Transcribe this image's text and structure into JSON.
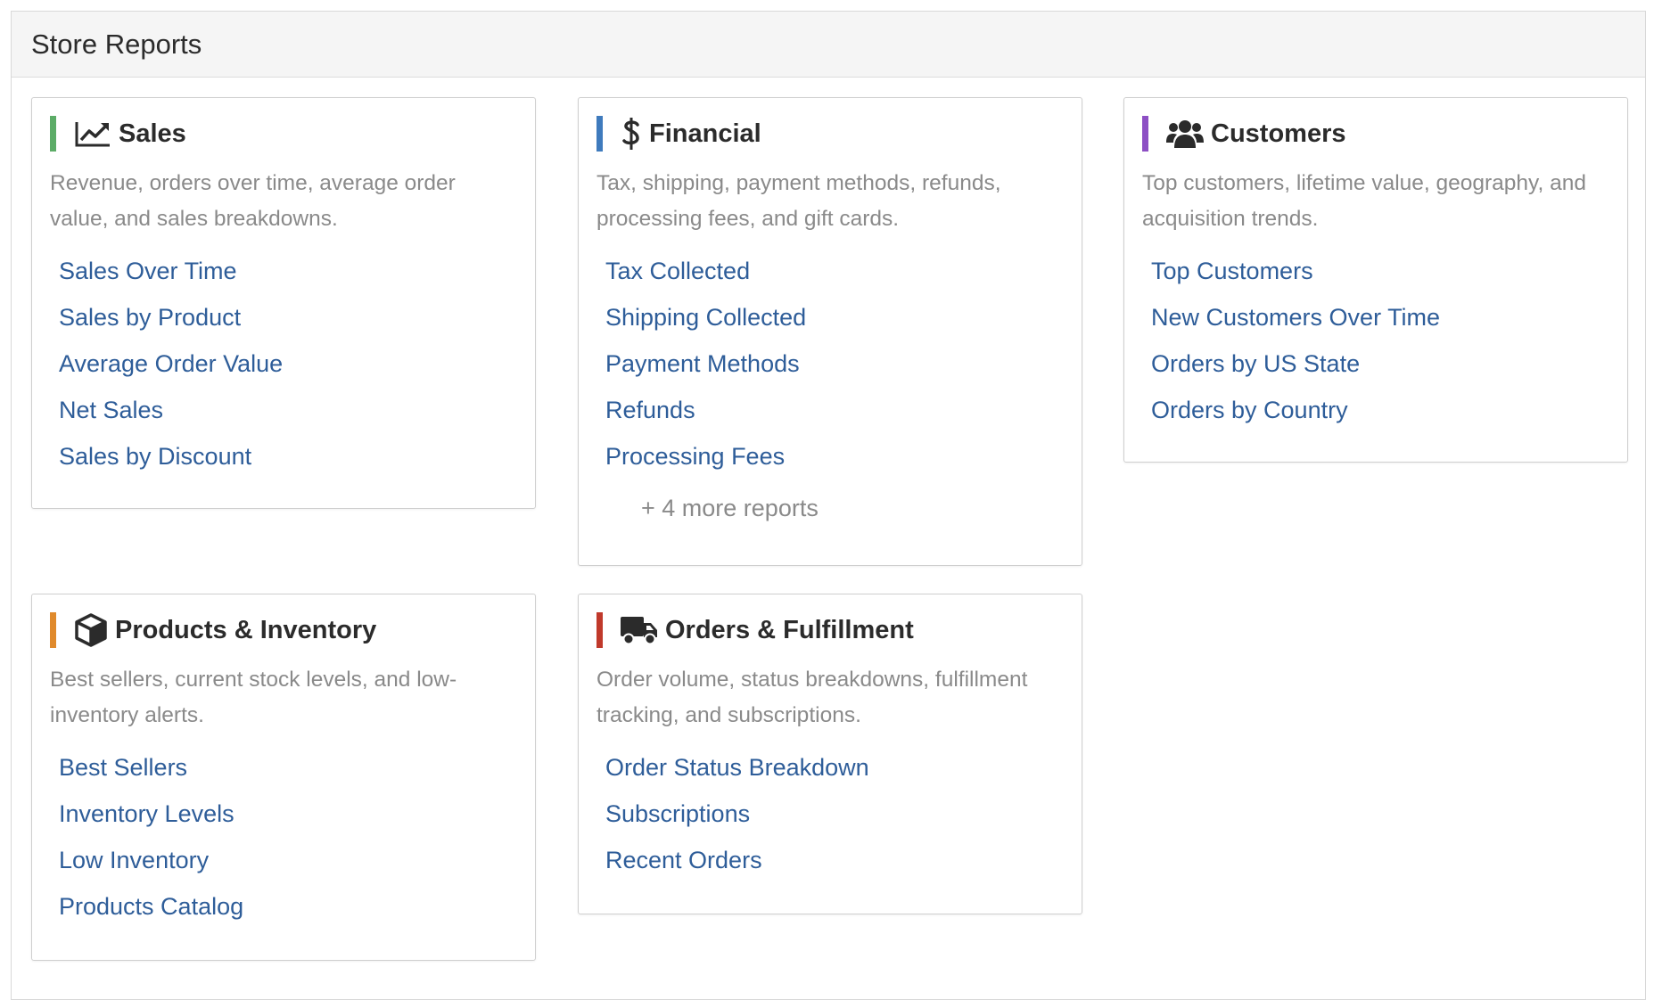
{
  "page": {
    "title": "Store Reports"
  },
  "cards": {
    "sales": {
      "title": "Sales",
      "icon": "line-chart-icon",
      "accent": "#5cac67",
      "description": "Revenue, orders over time, average order value, and sales breakdowns.",
      "links": [
        "Sales Over Time",
        "Sales by Product",
        "Average Order Value",
        "Net Sales",
        "Sales by Discount"
      ]
    },
    "financial": {
      "title": "Financial",
      "icon": "dollar-icon",
      "accent": "#3f7bbd",
      "description": "Tax, shipping, payment methods, refunds, processing fees, and gift cards.",
      "links": [
        "Tax Collected",
        "Shipping Collected",
        "Payment Methods",
        "Refunds",
        "Processing Fees"
      ],
      "more": "+ 4 more reports"
    },
    "customers": {
      "title": "Customers",
      "icon": "users-icon",
      "accent": "#8d4fc4",
      "description": "Top customers, lifetime value, geography, and acquisition trends.",
      "links": [
        "Top Customers",
        "New Customers Over Time",
        "Orders by US State",
        "Orders by Country"
      ]
    },
    "products": {
      "title": "Products & Inventory",
      "icon": "box-icon",
      "accent": "#e08a2c",
      "description": "Best sellers, current stock levels, and low-inventory alerts.",
      "links": [
        "Best Sellers",
        "Inventory Levels",
        "Low Inventory",
        "Products Catalog"
      ]
    },
    "orders": {
      "title": "Orders & Fulfillment",
      "icon": "truck-icon",
      "accent": "#c0392b",
      "description": "Order volume, status breakdowns, fulfillment tracking, and subscriptions.",
      "links": [
        "Order Status Breakdown",
        "Subscriptions",
        "Recent Orders"
      ]
    }
  }
}
